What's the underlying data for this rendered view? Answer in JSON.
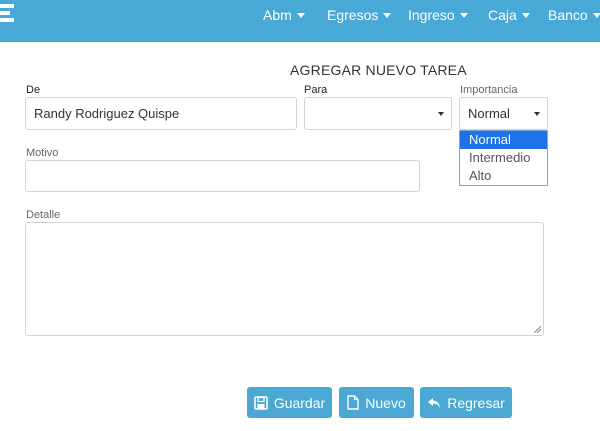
{
  "nav": {
    "items": [
      {
        "label": "Abm"
      },
      {
        "label": "Egresos"
      },
      {
        "label": "Ingreso"
      },
      {
        "label": "Caja"
      },
      {
        "label": "Banco"
      }
    ]
  },
  "form": {
    "title": "AGREGAR NUEVO TAREA",
    "de": {
      "label": "De",
      "value": "Randy Rodriguez Quispe"
    },
    "para": {
      "label": "Para",
      "value": ""
    },
    "importancia": {
      "label": "Importancia",
      "selected": "Normal",
      "options": [
        "Normal",
        "Intermedio",
        "Alto"
      ],
      "highlighted_index": 0
    },
    "motivo": {
      "label": "Motivo",
      "value": ""
    },
    "detalle": {
      "label": "Detalle",
      "value": ""
    }
  },
  "buttons": {
    "guardar": "Guardar",
    "nuevo": "Nuevo",
    "regresar": "Regresar"
  },
  "colors": {
    "navbar": "#48a8d6",
    "button": "#4aa8d3",
    "dropdown_highlight": "#1e73e8"
  }
}
